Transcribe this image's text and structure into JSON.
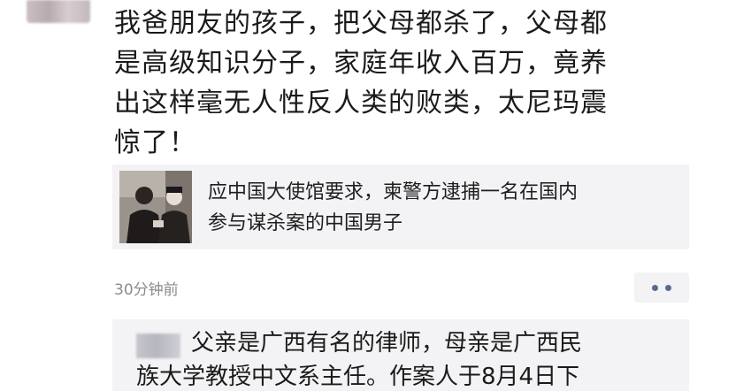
{
  "post": {
    "author_avatar_icon": "blurred-avatar",
    "text": "我爸朋友的孩子，把父母都杀了，父母都\n是高级知识分子，家庭年收入百万，竟养\n出这样毫无人性反人类的败类，太尼玛震\n惊了！"
  },
  "link_card": {
    "thumbnail_icon": "news-photo-thumbnail",
    "title": "应中国大使馆要求，柬警方逮捕一名在国内\n参与谋杀案的中国男子"
  },
  "meta": {
    "time": "30分钟前",
    "more_icon": "more-dots-icon"
  },
  "comments": {
    "first": {
      "author_icon": "blurred-name",
      "text": "父亲是广西有名的律师，母亲是广西民\n族大学教授中文系主任。作案人于8月4日下"
    }
  }
}
